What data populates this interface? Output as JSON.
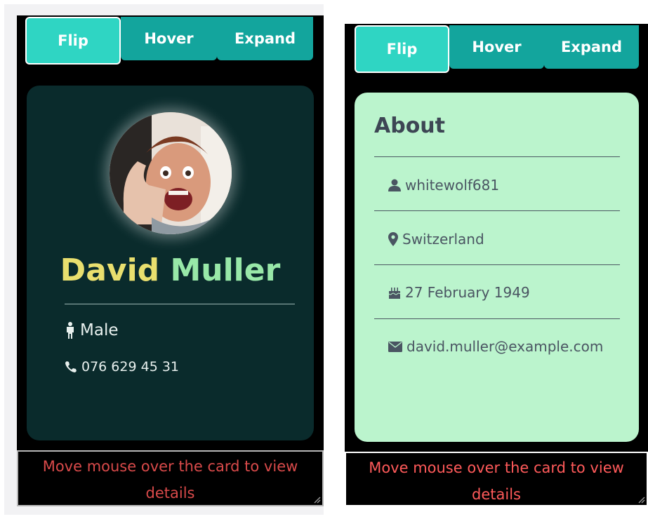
{
  "tabs": {
    "flip": "Flip",
    "hover": "Hover",
    "expand": "Expand"
  },
  "front": {
    "first_name": "David",
    "last_name": "Muller",
    "gender": "Male",
    "phone": "076 629 45 31"
  },
  "back": {
    "title": "About",
    "username": "whitewolf681",
    "location": "Switzerland",
    "birthday": "27 February 1949",
    "email": "david.muller@example.com"
  },
  "footer": {
    "hint": "Move mouse over the card to view details"
  },
  "colors": {
    "tab": "#13a59d",
    "tab_active": "#2fd5c3",
    "card_front": "#0a2b2c",
    "card_back": "#bbf4cd",
    "first_name": "#e9df6e",
    "last_name": "#98e8a8",
    "hint": "#d94a4a"
  },
  "icons": [
    "person-standing-icon",
    "phone-icon",
    "user-icon",
    "map-pin-icon",
    "birthday-cake-icon",
    "envelope-icon",
    "resize-grip-icon"
  ]
}
